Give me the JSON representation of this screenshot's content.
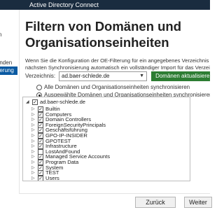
{
  "window": {
    "title": "Active Directory Connect"
  },
  "sidebar": {
    "items": [
      {
        "label": "n"
      },
      {
        "label": "erbinden"
      },
      {
        "label": "-Filterung"
      },
      {
        "label": "ires"
      }
    ]
  },
  "main": {
    "heading_line1": "Filtern von Domänen und",
    "heading_line2": "Organisationseinheiten",
    "desc_line1": "Wenn Sie die Konfiguration der OE-Filterung für ein angegebenes Verzeichnis ändern, wird",
    "desc_line2": "nächsten Synchronisierung automatisch ein vollständiger Import für das Verzeichnis durchg",
    "directory_label": "Verzeichnis:",
    "directory_value": "ad.baer-schlede.de",
    "refresh_button": "Domänen aktualisieren",
    "help_icon": "?",
    "radio_all": "Alle Domänen und Organisationseinheiten synchronisieren",
    "radio_selected": "Ausgewählte Domänen und Organisationseinheiten synchronisieren",
    "tree_root": "ad.baer-schlede.de",
    "tree_items": [
      {
        "label": "Builtin",
        "checked": true
      },
      {
        "label": "Computers",
        "checked": true
      },
      {
        "label": "Domain Controllers",
        "checked": true
      },
      {
        "label": "ForeignSecurityPrincipals",
        "checked": true
      },
      {
        "label": "Geschäftsführung",
        "checked": true
      },
      {
        "label": "GPO-IP-INSIDER",
        "checked": true
      },
      {
        "label": "GPOTEST",
        "checked": true
      },
      {
        "label": "Infrastructure",
        "checked": true
      },
      {
        "label": "LostAndFound",
        "checked": false
      },
      {
        "label": "Managed Service Accounts",
        "checked": true
      },
      {
        "label": "Program Data",
        "checked": true
      },
      {
        "label": "System",
        "checked": true
      },
      {
        "label": "TEST",
        "checked": true
      },
      {
        "label": "Users",
        "checked": true
      }
    ]
  },
  "footer": {
    "back_button": "Zurück",
    "next_button": "Weiter"
  },
  "colors": {
    "titlebar": "#1a2c3f",
    "accent": "#0a5aa2",
    "refresh": "#2d7d33"
  }
}
